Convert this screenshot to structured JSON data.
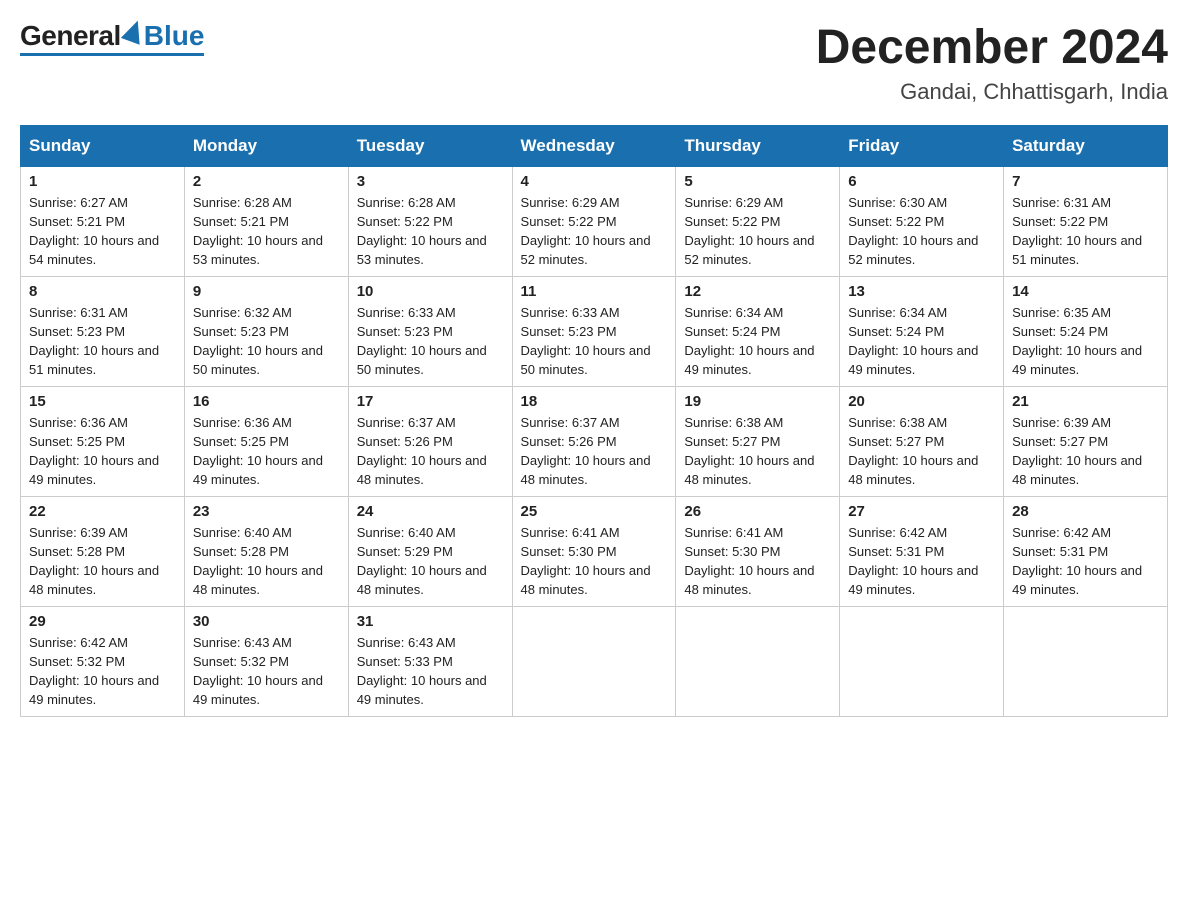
{
  "header": {
    "logo": {
      "general": "General",
      "blue": "Blue"
    },
    "title": "December 2024",
    "subtitle": "Gandai, Chhattisgarh, India"
  },
  "weekdays": [
    "Sunday",
    "Monday",
    "Tuesday",
    "Wednesday",
    "Thursday",
    "Friday",
    "Saturday"
  ],
  "weeks": [
    [
      {
        "day": "1",
        "sunrise": "6:27 AM",
        "sunset": "5:21 PM",
        "daylight": "10 hours and 54 minutes."
      },
      {
        "day": "2",
        "sunrise": "6:28 AM",
        "sunset": "5:21 PM",
        "daylight": "10 hours and 53 minutes."
      },
      {
        "day": "3",
        "sunrise": "6:28 AM",
        "sunset": "5:22 PM",
        "daylight": "10 hours and 53 minutes."
      },
      {
        "day": "4",
        "sunrise": "6:29 AM",
        "sunset": "5:22 PM",
        "daylight": "10 hours and 52 minutes."
      },
      {
        "day": "5",
        "sunrise": "6:29 AM",
        "sunset": "5:22 PM",
        "daylight": "10 hours and 52 minutes."
      },
      {
        "day": "6",
        "sunrise": "6:30 AM",
        "sunset": "5:22 PM",
        "daylight": "10 hours and 52 minutes."
      },
      {
        "day": "7",
        "sunrise": "6:31 AM",
        "sunset": "5:22 PM",
        "daylight": "10 hours and 51 minutes."
      }
    ],
    [
      {
        "day": "8",
        "sunrise": "6:31 AM",
        "sunset": "5:23 PM",
        "daylight": "10 hours and 51 minutes."
      },
      {
        "day": "9",
        "sunrise": "6:32 AM",
        "sunset": "5:23 PM",
        "daylight": "10 hours and 50 minutes."
      },
      {
        "day": "10",
        "sunrise": "6:33 AM",
        "sunset": "5:23 PM",
        "daylight": "10 hours and 50 minutes."
      },
      {
        "day": "11",
        "sunrise": "6:33 AM",
        "sunset": "5:23 PM",
        "daylight": "10 hours and 50 minutes."
      },
      {
        "day": "12",
        "sunrise": "6:34 AM",
        "sunset": "5:24 PM",
        "daylight": "10 hours and 49 minutes."
      },
      {
        "day": "13",
        "sunrise": "6:34 AM",
        "sunset": "5:24 PM",
        "daylight": "10 hours and 49 minutes."
      },
      {
        "day": "14",
        "sunrise": "6:35 AM",
        "sunset": "5:24 PM",
        "daylight": "10 hours and 49 minutes."
      }
    ],
    [
      {
        "day": "15",
        "sunrise": "6:36 AM",
        "sunset": "5:25 PM",
        "daylight": "10 hours and 49 minutes."
      },
      {
        "day": "16",
        "sunrise": "6:36 AM",
        "sunset": "5:25 PM",
        "daylight": "10 hours and 49 minutes."
      },
      {
        "day": "17",
        "sunrise": "6:37 AM",
        "sunset": "5:26 PM",
        "daylight": "10 hours and 48 minutes."
      },
      {
        "day": "18",
        "sunrise": "6:37 AM",
        "sunset": "5:26 PM",
        "daylight": "10 hours and 48 minutes."
      },
      {
        "day": "19",
        "sunrise": "6:38 AM",
        "sunset": "5:27 PM",
        "daylight": "10 hours and 48 minutes."
      },
      {
        "day": "20",
        "sunrise": "6:38 AM",
        "sunset": "5:27 PM",
        "daylight": "10 hours and 48 minutes."
      },
      {
        "day": "21",
        "sunrise": "6:39 AM",
        "sunset": "5:27 PM",
        "daylight": "10 hours and 48 minutes."
      }
    ],
    [
      {
        "day": "22",
        "sunrise": "6:39 AM",
        "sunset": "5:28 PM",
        "daylight": "10 hours and 48 minutes."
      },
      {
        "day": "23",
        "sunrise": "6:40 AM",
        "sunset": "5:28 PM",
        "daylight": "10 hours and 48 minutes."
      },
      {
        "day": "24",
        "sunrise": "6:40 AM",
        "sunset": "5:29 PM",
        "daylight": "10 hours and 48 minutes."
      },
      {
        "day": "25",
        "sunrise": "6:41 AM",
        "sunset": "5:30 PM",
        "daylight": "10 hours and 48 minutes."
      },
      {
        "day": "26",
        "sunrise": "6:41 AM",
        "sunset": "5:30 PM",
        "daylight": "10 hours and 48 minutes."
      },
      {
        "day": "27",
        "sunrise": "6:42 AM",
        "sunset": "5:31 PM",
        "daylight": "10 hours and 49 minutes."
      },
      {
        "day": "28",
        "sunrise": "6:42 AM",
        "sunset": "5:31 PM",
        "daylight": "10 hours and 49 minutes."
      }
    ],
    [
      {
        "day": "29",
        "sunrise": "6:42 AM",
        "sunset": "5:32 PM",
        "daylight": "10 hours and 49 minutes."
      },
      {
        "day": "30",
        "sunrise": "6:43 AM",
        "sunset": "5:32 PM",
        "daylight": "10 hours and 49 minutes."
      },
      {
        "day": "31",
        "sunrise": "6:43 AM",
        "sunset": "5:33 PM",
        "daylight": "10 hours and 49 minutes."
      },
      null,
      null,
      null,
      null
    ]
  ]
}
